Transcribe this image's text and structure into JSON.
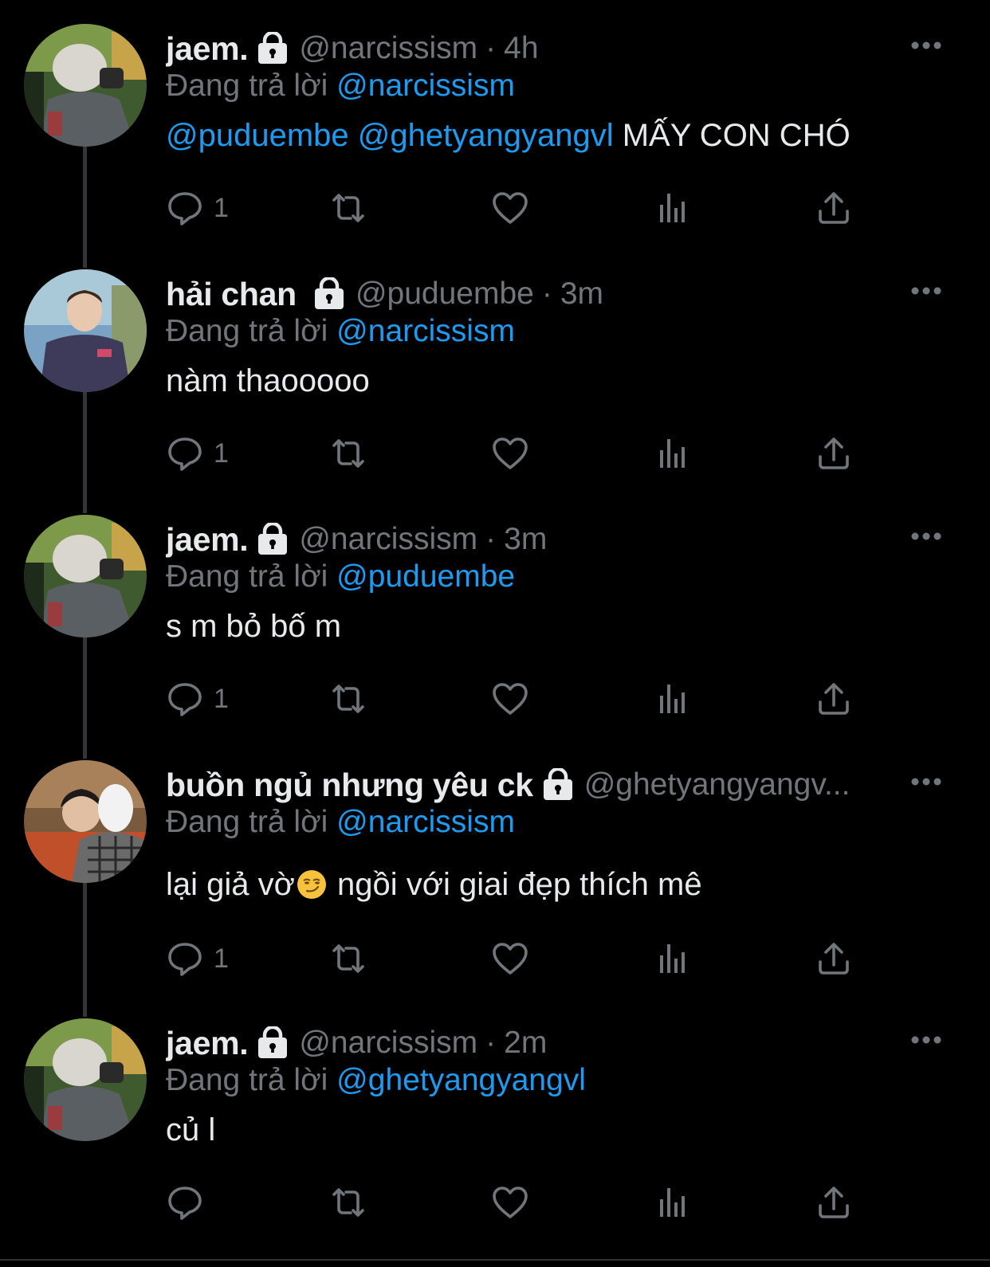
{
  "reply_prefix": "Đang trả lời",
  "tweets": [
    {
      "name": "jaem.",
      "handle": "@narcissism",
      "separator": "·",
      "time": "4h",
      "reply_to": "@narcissism",
      "mentions": [
        "@puduembe",
        "@ghetyangyangvl"
      ],
      "text": "MẤY CON CHÓ",
      "reply_count": "1"
    },
    {
      "name": "hải chan",
      "handle": "@puduembe",
      "separator": "·",
      "time": "3m",
      "reply_to": "@narcissism",
      "text": "nàm thaooooo",
      "reply_count": "1"
    },
    {
      "name": "jaem.",
      "handle": "@narcissism",
      "separator": "·",
      "time": "3m",
      "reply_to": "@puduembe",
      "text": "s m bỏ bố m",
      "reply_count": "1"
    },
    {
      "name": "buồn ngủ nhưng yêu ck",
      "handle": "@ghetyangyangv...",
      "reply_to": "@narcissism",
      "text_before_emoji": "lại giả vờ",
      "emoji": "smirking-face-emoji",
      "text_after_emoji": " ngồi với giai đẹp thích mê",
      "reply_count": "1"
    },
    {
      "name": "jaem.",
      "handle": "@narcissism",
      "separator": "·",
      "time": "2m",
      "reply_to": "@ghetyangyangvl",
      "text": "củ l",
      "reply_count": ""
    }
  ],
  "icons": {
    "lock": "lock-icon",
    "more": "more-options-icon",
    "reply": "reply-icon",
    "retweet": "retweet-icon",
    "like": "like-icon",
    "views": "views-icon",
    "share": "share-icon"
  },
  "colors": {
    "background": "#000000",
    "text": "#e7e9ea",
    "secondary": "#71767b",
    "mention": "#1d9bf0",
    "thread_line": "#333639"
  }
}
